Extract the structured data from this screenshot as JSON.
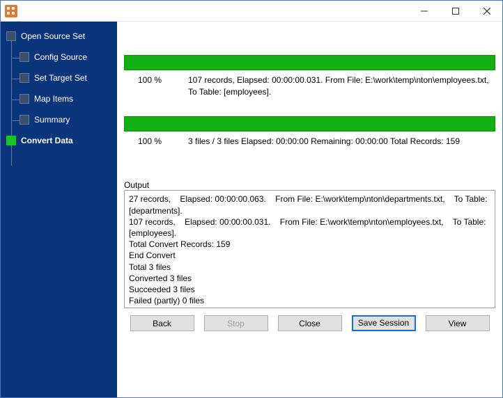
{
  "titlebar": {
    "title": ""
  },
  "sidebar": {
    "items": [
      {
        "label": "Open Source Set"
      },
      {
        "label": "Config Source"
      },
      {
        "label": "Set Target Set"
      },
      {
        "label": "Map Items"
      },
      {
        "label": "Summary"
      },
      {
        "label": "Convert Data"
      }
    ]
  },
  "progress": {
    "file": {
      "percent": "100 %",
      "text": "107 records,    Elapsed: 00:00:00.031.    From File: E:\\work\\temp\\nton\\employees.txt,    To Table: [employees]."
    },
    "overall": {
      "percent": "100 %",
      "text": "3 files / 3 files    Elapsed: 00:00:00    Remaining: 00:00:00    Total Records: 159"
    }
  },
  "output": {
    "label": "Output",
    "text": "27 records,    Elapsed: 00:00:00.063.    From File: E:\\work\\temp\\nton\\departments.txt,    To Table: [departments].\n107 records,    Elapsed: 00:00:00.031.    From File: E:\\work\\temp\\nton\\employees.txt,    To Table: [employees].\nTotal Convert Records: 159\nEnd Convert\nTotal 3 files\nConverted 3 files\nSucceeded 3 files\nFailed (partly) 0 files"
  },
  "buttons": {
    "back": "Back",
    "stop": "Stop",
    "close": "Close",
    "save_session": "Save Session",
    "view": "View"
  }
}
